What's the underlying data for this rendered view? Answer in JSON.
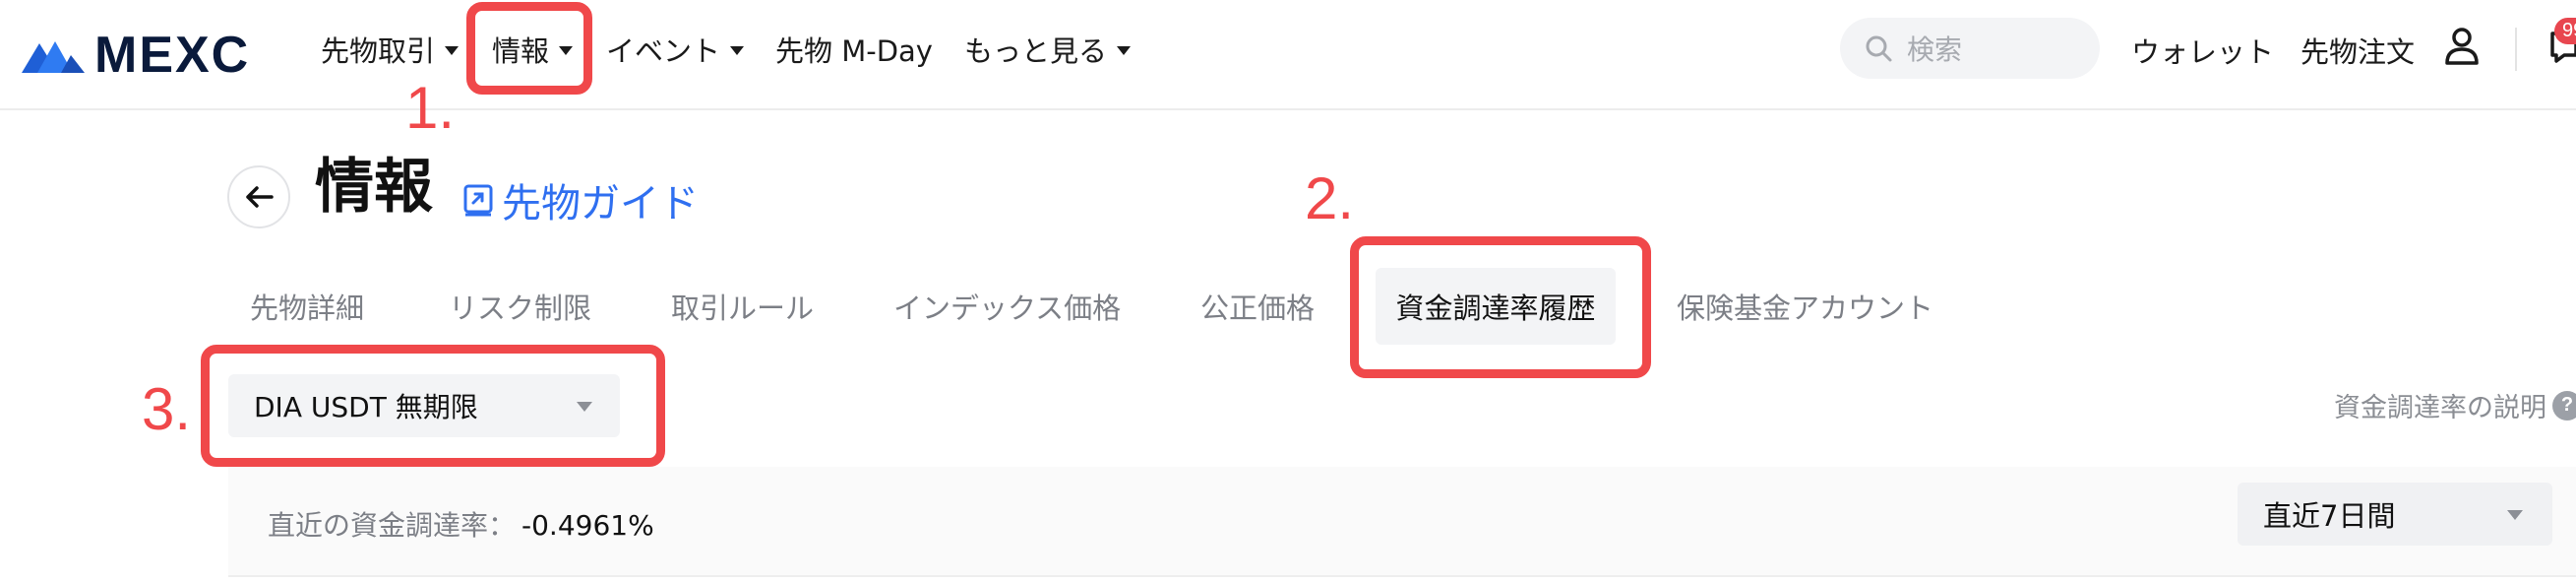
{
  "brand": {
    "name": "MEXC",
    "accent": "#2f6ff0",
    "annotation_color": "#f0484a"
  },
  "nav": {
    "items": [
      {
        "label": "先物取引",
        "has_dropdown": true
      },
      {
        "label": "情報",
        "has_dropdown": true
      },
      {
        "label": "イベント",
        "has_dropdown": true
      },
      {
        "label": "先物 M-Day",
        "has_dropdown": false
      },
      {
        "label": "もっと見る",
        "has_dropdown": true
      }
    ],
    "search_placeholder": "検索",
    "wallet_label": "ウォレット",
    "futures_order_label": "先物注文",
    "notification_count": "99"
  },
  "header": {
    "title": "情報",
    "guide_link": "先物ガイド"
  },
  "tabs": [
    {
      "label": "先物詳細"
    },
    {
      "label": "リスク制限"
    },
    {
      "label": "取引ルール"
    },
    {
      "label": "インデックス価格"
    },
    {
      "label": "公正価格"
    },
    {
      "label": "資金調達率履歴",
      "active": true
    },
    {
      "label": "保険基金アカウント"
    }
  ],
  "contract_select": {
    "value": "DIA USDT 無期限"
  },
  "funding_explain": {
    "label": "資金調達率の説明",
    "icon": "question-icon"
  },
  "rate": {
    "label": "直近の資金調達率：",
    "value": "-0.4961%"
  },
  "period_select": {
    "value": "直近7日間"
  },
  "annotations": [
    {
      "number": "1."
    },
    {
      "number": "2."
    },
    {
      "number": "3."
    }
  ]
}
